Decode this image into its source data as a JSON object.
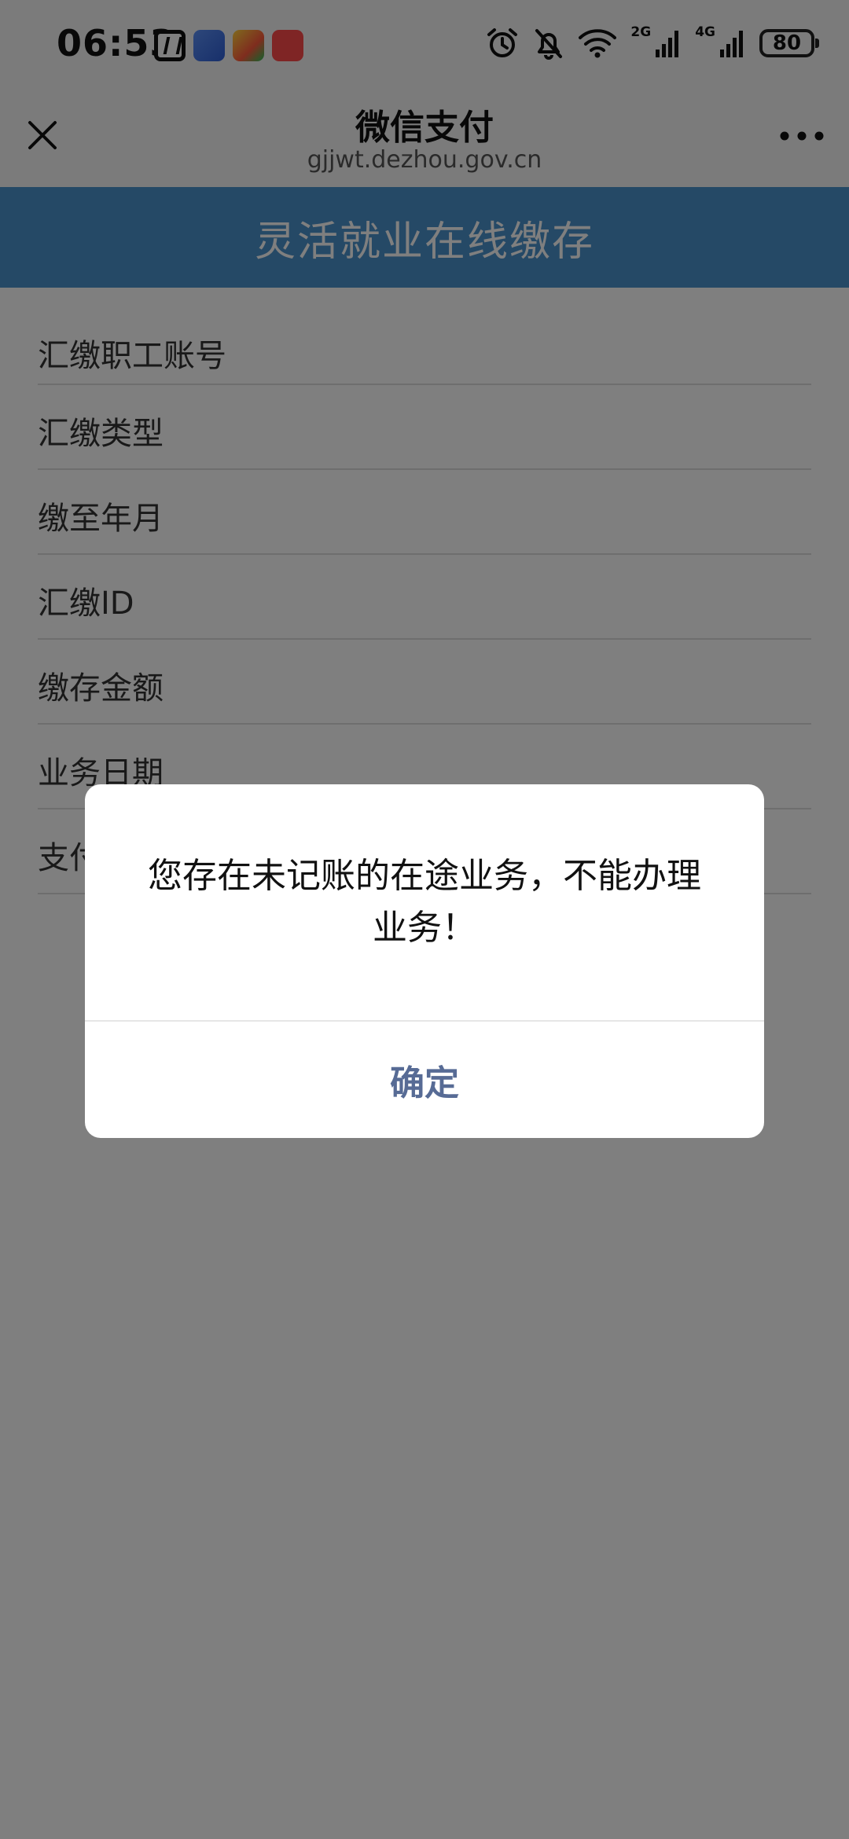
{
  "status_bar": {
    "time": "06:53",
    "network_2g": "2G",
    "network_4g": "4G",
    "battery": "80",
    "app_icons": [
      "nfc-icon",
      "browser-app-icon",
      "video-app-icon",
      "reader-app-icon"
    ],
    "indicators": [
      "alarm-icon",
      "mute-bell-icon",
      "wifi-icon",
      "signal-2g-icon",
      "signal-4g-icon",
      "battery-icon"
    ]
  },
  "header": {
    "title": "微信支付",
    "url": "gjjwt.dezhou.gov.cn",
    "close_icon": "close-icon",
    "more_icon": "more-dots-icon"
  },
  "page": {
    "banner": "灵活就业在线缴存",
    "banner_color": "#4a93cc",
    "fields": [
      {
        "label": "汇缴职工账号"
      },
      {
        "label": "汇缴类型"
      },
      {
        "label": "缴至年月"
      },
      {
        "label": "汇缴ID"
      },
      {
        "label": "缴存金额"
      },
      {
        "label": "业务日期"
      },
      {
        "label": "支付"
      }
    ]
  },
  "dialog": {
    "message": "您存在未记账的在途业务，不能办理业务！",
    "confirm_label": "确定",
    "confirm_color": "#576b95"
  }
}
